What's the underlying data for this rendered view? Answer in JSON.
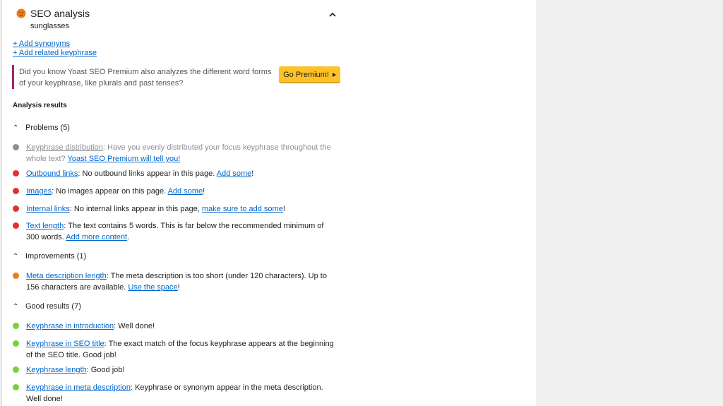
{
  "seo": {
    "title": "SEO analysis",
    "keyphrase": "sunglasses",
    "face_color": "#ee7c1b"
  },
  "links": {
    "add_synonyms": "+ Add synonyms",
    "add_related": "+ Add related keyphrase"
  },
  "promo": {
    "text": "Did you know Yoast SEO Premium also analyzes the different word forms of your keyphrase, like plurals and past tenses?",
    "button": "Go Premium!"
  },
  "analysis_title": "Analysis results",
  "colors": {
    "problem": "#dc3232",
    "improvement": "#ee7c1b",
    "good": "#7ad03a",
    "disabled": "#8c8f94",
    "link": "#0066cc"
  },
  "problems": {
    "heading": "Problems (5)",
    "items": [
      {
        "link": "Keyphrase distribution",
        "text": ": Have you evenly distributed your focus keyphrase throughout the whole text? ",
        "cta": "Yoast SEO Premium will tell you!",
        "tail": ""
      },
      {
        "link": "Outbound links",
        "text": ": No outbound links appear in this page. ",
        "cta": "Add some",
        "tail": "!"
      },
      {
        "link": "Images",
        "text": ": No images appear on this page. ",
        "cta": "Add some",
        "tail": "!"
      },
      {
        "link": "Internal links",
        "text": ": No internal links appear in this page, ",
        "cta": "make sure to add some",
        "tail": "!"
      },
      {
        "link": "Text length",
        "text": ": The text contains 5 words. This is far below the recommended minimum of 300 words. ",
        "cta": "Add more content",
        "tail": "."
      }
    ]
  },
  "improvements": {
    "heading": "Improvements (1)",
    "items": [
      {
        "link": "Meta description length",
        "text": ": The meta description is too short (under 120 characters). Up to 156 characters are available. ",
        "cta": "Use the space",
        "tail": "!"
      }
    ]
  },
  "good": {
    "heading": "Good results (7)",
    "items": [
      {
        "link": "Keyphrase in introduction",
        "text": ": Well done!"
      },
      {
        "link": "Keyphrase in SEO title",
        "text": ": The exact match of the focus keyphrase appears at the beginning of the SEO title. Good job!"
      },
      {
        "link": "Keyphrase length",
        "text": ": Good job!"
      },
      {
        "link": "Keyphrase in meta description",
        "text": ": Keyphrase or synonym appear in the meta description. Well done!"
      }
    ]
  }
}
